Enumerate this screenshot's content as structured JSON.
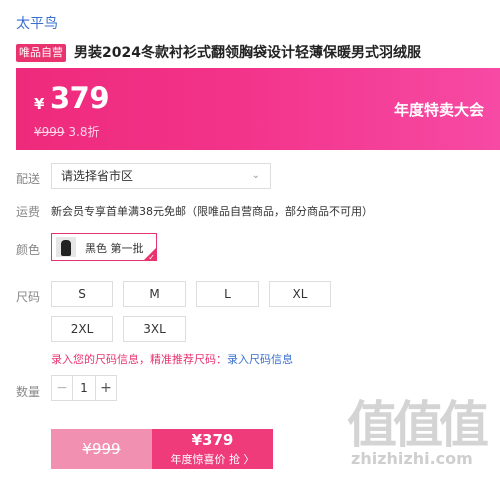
{
  "brand": "太平鸟",
  "badge": "唯品自营",
  "title": "男装2024冬款衬衫式翻领胸袋设计轻薄保暖男式羽绒服",
  "price": {
    "currency": "¥",
    "value": "379",
    "original": "¥999",
    "discount": "3.8折",
    "event": "年度特卖大会"
  },
  "delivery": {
    "label": "配送",
    "placeholder": "请选择省市区"
  },
  "shipping": {
    "label": "运费",
    "text": "新会员专享首单满38元免邮（限唯品自营商品，部分商品不可用）"
  },
  "color": {
    "label": "颜色",
    "option": "黑色 第一批"
  },
  "size": {
    "label": "尺码",
    "options": [
      "S",
      "M",
      "L",
      "XL",
      "2XL",
      "3XL"
    ],
    "prompt": "录入您的尺码信息，精准推荐尺码：",
    "link": "录入尺码信息"
  },
  "quantity": {
    "label": "数量",
    "value": "1",
    "minus": "−",
    "plus": "+"
  },
  "buy": {
    "original": "¥999",
    "price": "¥379",
    "cta": "年度惊喜价 抢 〉"
  },
  "watermark": {
    "glyphs": "值值值",
    "domain": "zhizhizhi.com"
  },
  "colors": {
    "accent": "#e8336f",
    "link": "#3a6fcf",
    "banner_start": "#ee2a7b",
    "banner_end": "#f64aa4"
  }
}
